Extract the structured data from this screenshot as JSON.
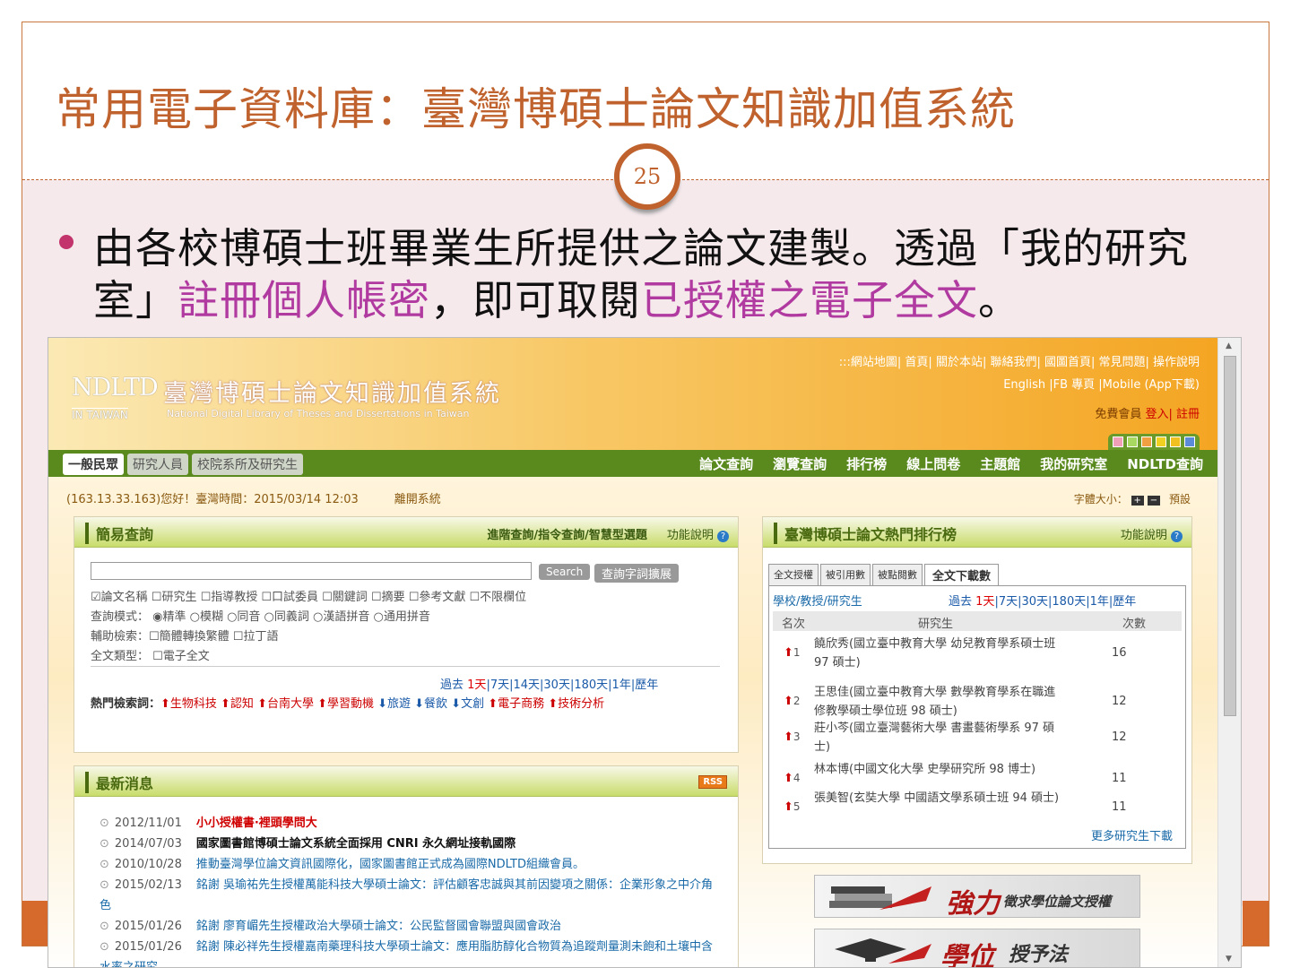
{
  "slide": {
    "title": "常用電子資料庫：臺灣博碩士論文知識加值系統",
    "page_number": "25",
    "bullet_parts": [
      "由各校博碩士班畢業生所提供之論文建製。透過「我的研究室」",
      "註冊個人帳密",
      "，即可取閱",
      "已授權之電子全文",
      "。"
    ]
  },
  "site": {
    "logo_en_top": "NDLTD",
    "logo_en_bottom": "IN TAIWAN",
    "logo_cn": "臺灣博碩士論文知識加值系統",
    "logo_sub": "National Digital Library of Theses and Dissertations in Taiwan",
    "toplinks_1": ":::網站地圖| 首頁| 關於本站| 聯絡我們| 國圖首頁| 常見問題| 操作說明",
    "toplinks_2": "English |FB 專頁 |Mobile (App下載)",
    "member_label": "免費會員",
    "login": "登入",
    "register": "| 註冊",
    "swatch_colors": [
      "#f2a0b8",
      "#a8d860",
      "#f0a040",
      "#f0d020",
      "#f0c020",
      "#5a8ad8"
    ],
    "user_tabs": [
      "一般民眾",
      "研究人員",
      "校院系所及研究生"
    ],
    "main_nav": [
      "論文查詢",
      "瀏覽查詢",
      "排行榜",
      "線上問卷",
      "主題館",
      "我的研究室",
      "NDLTD查詢"
    ],
    "greeting": "(163.13.33.163)您好！臺灣時間：2015/03/14 12:03",
    "logout": "離開系統",
    "font_size": "字體大小：",
    "font_size_plus": "+",
    "font_size_minus": "−",
    "font_size_default": "預設"
  },
  "simple_search": {
    "title": "簡易查詢",
    "advanced": "進階查詢/指令查詢/智慧型選題",
    "help": "功能說明",
    "search_btn": "Search",
    "expand_btn": "查詢字詞擴展",
    "fields_row": "☑論文名稱 ☐研究生 ☐指導教授 ☐口試委員 ☐關鍵詞 ☐摘要 ☐參考文獻 ☐不限欄位",
    "mode_row": "查詢模式： ◉精準 ○模糊 ○同音 ○同義詞 ○漢語拼音 ○通用拼音",
    "aux_row": "輔助檢索：☐簡體轉換繁體 ☐拉丁語",
    "type_row": "全文類型：  ☐電子全文",
    "period_label": "過去",
    "periods": [
      "1天",
      "|7天",
      "|14天",
      "|30天",
      "|180天",
      "|1年",
      "|歷年"
    ],
    "hot_label": "熱門檢索詞：",
    "hot_terms": "⬆生物科技  ⬆認知  ⬆台南大學  ⬆學習動機 ",
    "hot_terms_down": "⬇旅遊  ⬇餐飲  ⬇文創 ",
    "hot_terms_tail": " ⬆電子商務  ⬆技術分析"
  },
  "news": {
    "title": "最新消息",
    "rss": "RSS",
    "items": [
      {
        "date": "2012/11/01",
        "text": "小小授權書·裡頭學問大",
        "color": "#d00000"
      },
      {
        "date": "2014/07/03",
        "text": "國家圖書館博碩士論文系統全面採用 CNRI 永久網址接軌國際",
        "color": "#111111"
      },
      {
        "date": "2010/10/28",
        "text": "推動臺灣學位論文資訊國際化，國家圖書館正式成為國際NDLTD組織會員。",
        "color": "#1a6aa8"
      },
      {
        "date": "2015/02/13",
        "text": "銘謝 吳瑜祐先生授權萬能科技大學碩士論文：評估顧客忠誠與其前因變項之關係：企業形象之中介角色",
        "color": "#1a6aa8"
      },
      {
        "date": "2015/01/26",
        "text": "銘謝 廖育嵋先生授權政治大學碩士論文：公民監督國會聯盟與國會政治",
        "color": "#1a6aa8"
      },
      {
        "date": "2015/01/26",
        "text": "銘謝 陳必祥先生授權嘉南藥理科技大學碩士論文：應用脂肪醇化合物質為追蹤劑量測未飽和土壤中含水率之研究",
        "color": "#1a6aa8"
      }
    ]
  },
  "ranking": {
    "title": "臺灣博碩士論文熱門排行榜",
    "help": "功能說明",
    "tabs": [
      "全文授權",
      "被引用數",
      "被點閱數",
      "全文下載數"
    ],
    "filter": "學校/教授/研究生",
    "period_label": "過去",
    "periods": [
      "1天",
      "|7天",
      "|30天",
      "|180天",
      "|1年",
      "|歷年"
    ],
    "col_rank": "名次",
    "col_student": "研究生",
    "col_count": "次數",
    "rows": [
      {
        "rank": "1",
        "name": "饒欣秀(國立臺中教育大學 幼兒教育學系碩士班 97 碩士)",
        "count": "16"
      },
      {
        "rank": "2",
        "name": "王思佳(國立臺中教育大學 數學教育學系在職進修教學碩士學位班 98 碩士)",
        "count": "12"
      },
      {
        "rank": "3",
        "name": "莊小芩(國立臺灣藝術大學 書畫藝術學系 97 碩士)",
        "count": "12"
      },
      {
        "rank": "4",
        "name": "林本博(中國文化大學 史學研究所 98 博士)",
        "count": "11"
      },
      {
        "rank": "5",
        "name": "張美智(玄奘大學 中國語文學系碩士班 94 碩士)",
        "count": "11"
      }
    ],
    "more": "更多研究生下載"
  },
  "banners": [
    {
      "big": "強力",
      "small": "徵求學位論文授權"
    },
    {
      "big": "學位",
      "small": "授予法"
    }
  ]
}
